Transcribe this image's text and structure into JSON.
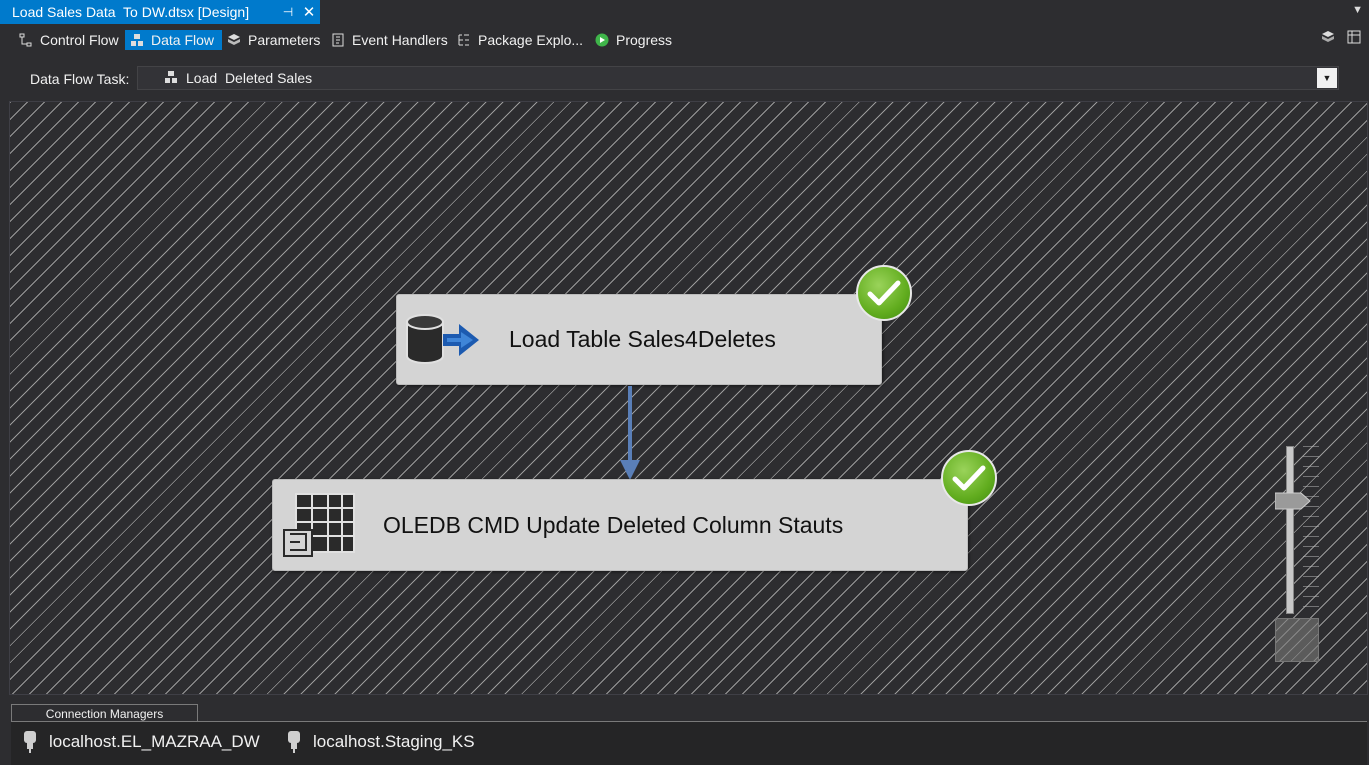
{
  "document_tab": {
    "title": "Load Sales Data  To DW.dtsx [Design]",
    "pin_icon": "pin-icon",
    "close_icon": "close-icon"
  },
  "designer_tabs": [
    {
      "label": "Control Flow",
      "icon": "control-flow-icon",
      "active": false
    },
    {
      "label": "Data Flow",
      "icon": "data-flow-icon",
      "active": true
    },
    {
      "label": "Parameters",
      "icon": "parameters-icon",
      "active": false
    },
    {
      "label": "Event Handlers",
      "icon": "event-handlers-icon",
      "active": false
    },
    {
      "label": "Package Explo...",
      "icon": "package-explorer-icon",
      "active": false
    },
    {
      "label": "Progress",
      "icon": "play-icon",
      "active": false
    }
  ],
  "task_selector": {
    "label": "Data Flow Task:",
    "value": "Load  Deleted Sales"
  },
  "components": [
    {
      "label": "Load Table Sales4Deletes",
      "icon": "ole-db-source-icon",
      "status": "success"
    },
    {
      "label": "OLEDB CMD Update Deleted Column Stauts",
      "icon": "ole-db-command-icon",
      "status": "success"
    }
  ],
  "connection_managers": {
    "title": "Connection Managers",
    "items": [
      "localhost.EL_MAZRAA_DW",
      "localhost.Staging_KS"
    ]
  },
  "colors": {
    "accent": "#007acc",
    "success": "#62ad1f",
    "path": "#5a7fb8",
    "component_bg": "#d4d4d4"
  }
}
